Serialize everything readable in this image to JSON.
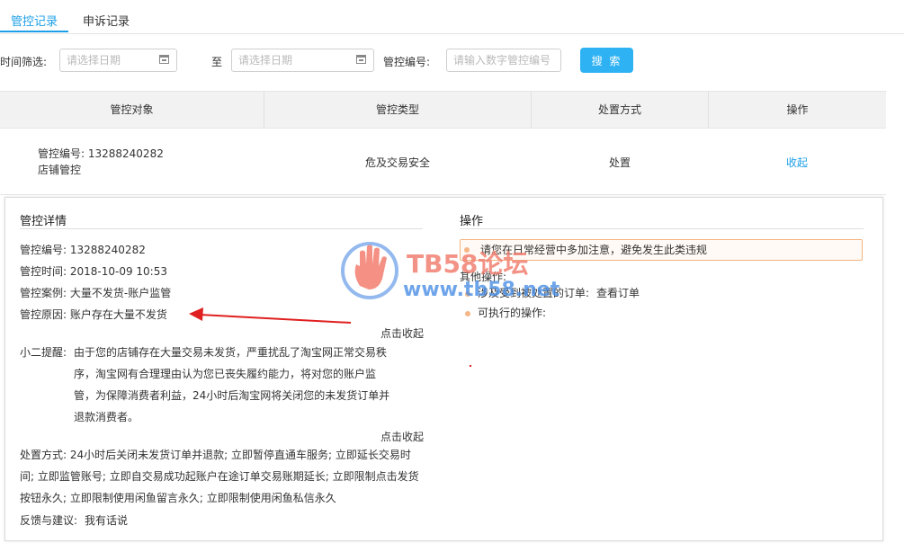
{
  "tabs": [
    {
      "label": "管控记录",
      "active": true
    },
    {
      "label": "申诉记录",
      "active": false
    }
  ],
  "filter": {
    "time_label": "时间筛选:",
    "date_placeholder": "请选择日期",
    "to_label": "至",
    "code_label": "管控编号:",
    "code_placeholder": "请输入数字管控编号",
    "search_button": "搜 索"
  },
  "table": {
    "headers": [
      "管控对象",
      "管控类型",
      "处置方式",
      "操作"
    ],
    "row": {
      "object_code": "管控编号: 13288240282",
      "object_type": "店铺管控",
      "type": "危及交易安全",
      "method": "处置",
      "action": "收起"
    }
  },
  "detail": {
    "title": "管控详情",
    "code": "管控编号: 13288240282",
    "time": "管控时间: 2018-10-09 10:53",
    "case": "管控案例: 大量不发货-账户监管",
    "reason": "管控原因: 账户存在大量不发货",
    "collapse_1": "点击收起",
    "tip_label": "小二提醒:",
    "tip_lines": [
      "由于您的店铺存在大量交易未发货，严重扰乱了淘宝网正常交易秩",
      "序，淘宝网有合理理由认为您已丧失履约能力，将对您的账户监",
      "管，为保障消费者利益，24小时后淘宝网将关闭您的未发货订单并",
      "退款消费者。"
    ],
    "collapse_2": "点击收起",
    "method_lines": [
      "处置方式: 24小时后关闭未发货订单并退款; 立即暂停直通车服务; 立即延长交易时",
      "间; 立即监管账号; 立即自交易成功起账户在途订单交易账期延长; 立即限制点击发货",
      "按钮永久; 立即限制使用闲鱼留言永久; 立即限制使用闲鱼私信永久"
    ],
    "feedback_label": "反馈与建议:",
    "feedback_link": "我有话说"
  },
  "operation": {
    "title": "操作",
    "warning": "请您在日常经营中多加注意，避免发生此类违规",
    "other_label": "其他操作:",
    "order_text": "涉及受到被处置的订单:",
    "order_link": "查看订单",
    "executable": "可执行的操作:"
  },
  "watermark": {
    "line1": "TB58论坛",
    "line2": "www.tb58.net"
  },
  "colors": {
    "accent": "#1c9fe8",
    "button": "#2fb2f3",
    "warning_border": "#f4b37d",
    "arrow": "#e02020"
  }
}
